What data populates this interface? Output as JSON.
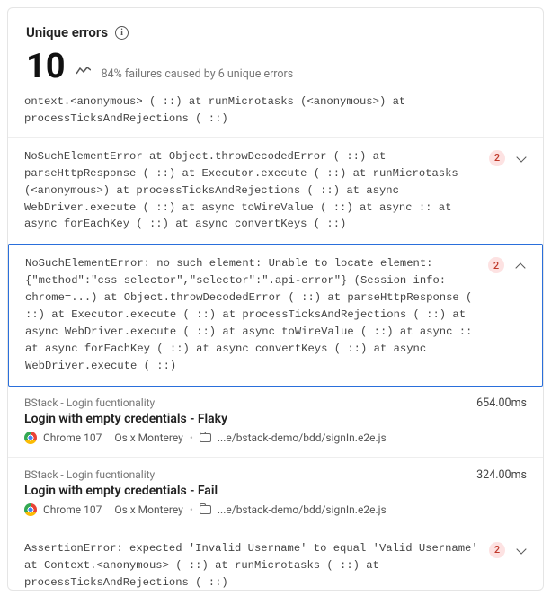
{
  "header": {
    "title": "Unique errors",
    "count": "10",
    "stats_text": "84% failures caused by 6 unique errors"
  },
  "errors": {
    "truncated_first": "ontext.<anonymous> ( ::) at runMicrotasks (<anonymous>) at processTicksAndRejections ( ::)",
    "e1": {
      "text": "NoSuchElementError at Object.throwDecodedError ( ::) at parseHttpResponse ( ::) at Executor.execute ( ::) at runMicrotasks (<anonymous>) at processTicksAndRejections ( ::) at async WebDriver.execute ( ::) at async toWireValue ( ::) at async :: at async forEachKey ( ::) at async convertKeys ( ::)",
      "count": "2"
    },
    "e2": {
      "text": "NoSuchElementError: no such element: Unable to locate element: {\"method\":\"css selector\",\"selector\":\".api-error\"} (Session info: chrome=...) at Object.throwDecodedError ( ::) at parseHttpResponse ( ::) at Executor.execute ( ::) at processTicksAndRejections ( ::) at async WebDriver.execute ( ::) at async toWireValue ( ::) at async :: at async forEachKey ( ::) at async convertKeys ( ::) at async WebDriver.execute ( ::)",
      "count": "2"
    },
    "e3": {
      "text": "AssertionError: expected 'Invalid Username' to equal 'Valid Username' at Context.<anonymous> ( ::) at runMicrotasks ( ::) at processTicksAndRejections ( ::)",
      "count": "2"
    }
  },
  "details": {
    "d1": {
      "suite": "BStack - Login fucntionality",
      "name": "Login with empty credentials - Flaky",
      "duration": "654.00ms",
      "browser": "Chrome 107",
      "os": "Os x Monterey",
      "file": "...e/bstack-demo/bdd/signIn.e2e.js"
    },
    "d2": {
      "suite": "BStack - Login fucntionality",
      "name": "Login with empty credentials - Fail",
      "duration": "324.00ms",
      "browser": "Chrome 107",
      "os": "Os x Monterey",
      "file": "...e/bstack-demo/bdd/signIn.e2e.js"
    }
  }
}
